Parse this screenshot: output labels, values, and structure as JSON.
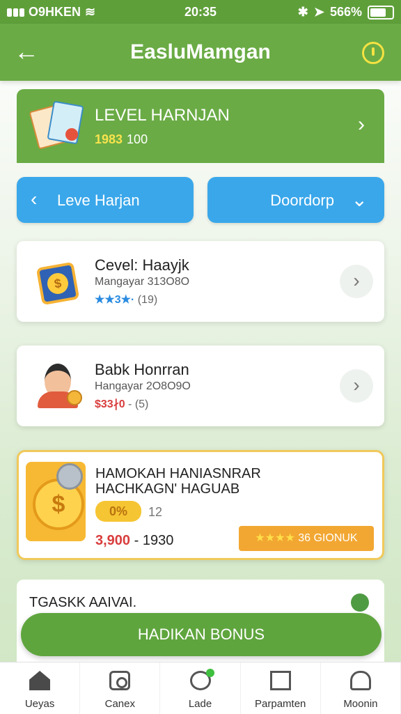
{
  "status_bar": {
    "carrier": "O9HKEN",
    "time": "20:35",
    "battery": "566%"
  },
  "header": {
    "title": "EasluMamgan"
  },
  "level_banner": {
    "title": "LEVEL HARNJAN",
    "score_highlight": "1983",
    "score_total": "100"
  },
  "pills": {
    "left_label": "Leve Harjan",
    "right_label": "Doordorp"
  },
  "cards": [
    {
      "name": "Cevel: Haayjk",
      "subtitle": "Mangayar 313O8O",
      "stars": "★★3★·",
      "count": "(19)"
    },
    {
      "name": "Babk Honrran",
      "subtitle": "Hangayar 2O8O9O",
      "price": "$33∤0",
      "count": "(5)"
    }
  ],
  "bonus": {
    "title_line1": "HAMOKAH HANIASNRAR",
    "title_line2": "HACHKAGN' HAGUAB",
    "percent": "0%",
    "count": "12",
    "range_low": "3,900",
    "range_high": "1930",
    "tag_stars": "★★★★",
    "tag_label": "36 GIONUK"
  },
  "panel": {
    "title": "TGASKK AAIVAI."
  },
  "cta": {
    "label": "HADIKAN BONUS"
  },
  "tabs": [
    {
      "label": "Ueyas"
    },
    {
      "label": "Canex"
    },
    {
      "label": "Lade"
    },
    {
      "label": "Parpamten"
    },
    {
      "label": "Moonin"
    }
  ]
}
